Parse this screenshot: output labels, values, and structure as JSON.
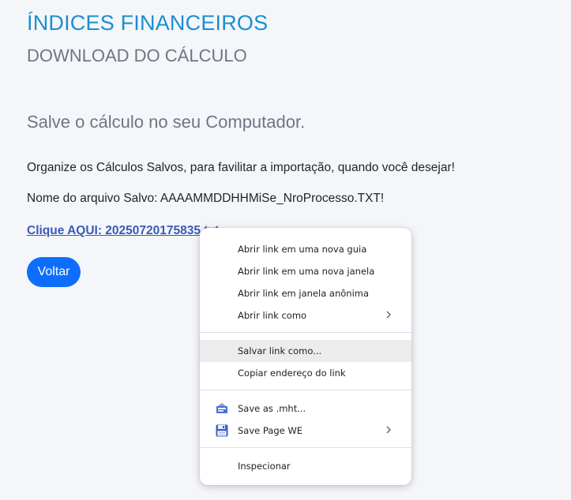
{
  "page": {
    "title": "ÍNDICES FINANCEIROS",
    "subtitle": "DOWNLOAD DO CÁLCULO",
    "heading": "Salve o cálculo no seu Computador.",
    "paragraph1": "Organize os Cálculos Salvos, para favilitar a importação, quando você desejar!",
    "paragraph2": "Nome do arquivo Salvo: AAAAMMDDHHMiSe_NroProcesso.TXT!",
    "download_link": "Clique AQUI: 20250720175835.txt",
    "back_button": "Voltar"
  },
  "context_menu": {
    "items": [
      {
        "label": "Abrir link em uma nova guia"
      },
      {
        "label": "Abrir link em uma nova janela"
      },
      {
        "label": "Abrir link em janela anônima"
      },
      {
        "label": "Abrir link como",
        "submenu": true
      },
      {
        "label": "Salvar link como...",
        "highlighted": true
      },
      {
        "label": "Copiar endereço do link"
      },
      {
        "label": "Save as .mht...",
        "icon": "mht-extension-icon"
      },
      {
        "label": "Save Page WE",
        "icon": "floppy-disk-icon",
        "submenu": true
      },
      {
        "label": "Inspecionar"
      }
    ]
  },
  "colors": {
    "title": "#1a8fd0",
    "subtitle": "#6f7680",
    "link": "#3a5bb5",
    "button": "#0d6efd",
    "background": "#f4f6fa",
    "menu_highlight": "#ececec"
  }
}
